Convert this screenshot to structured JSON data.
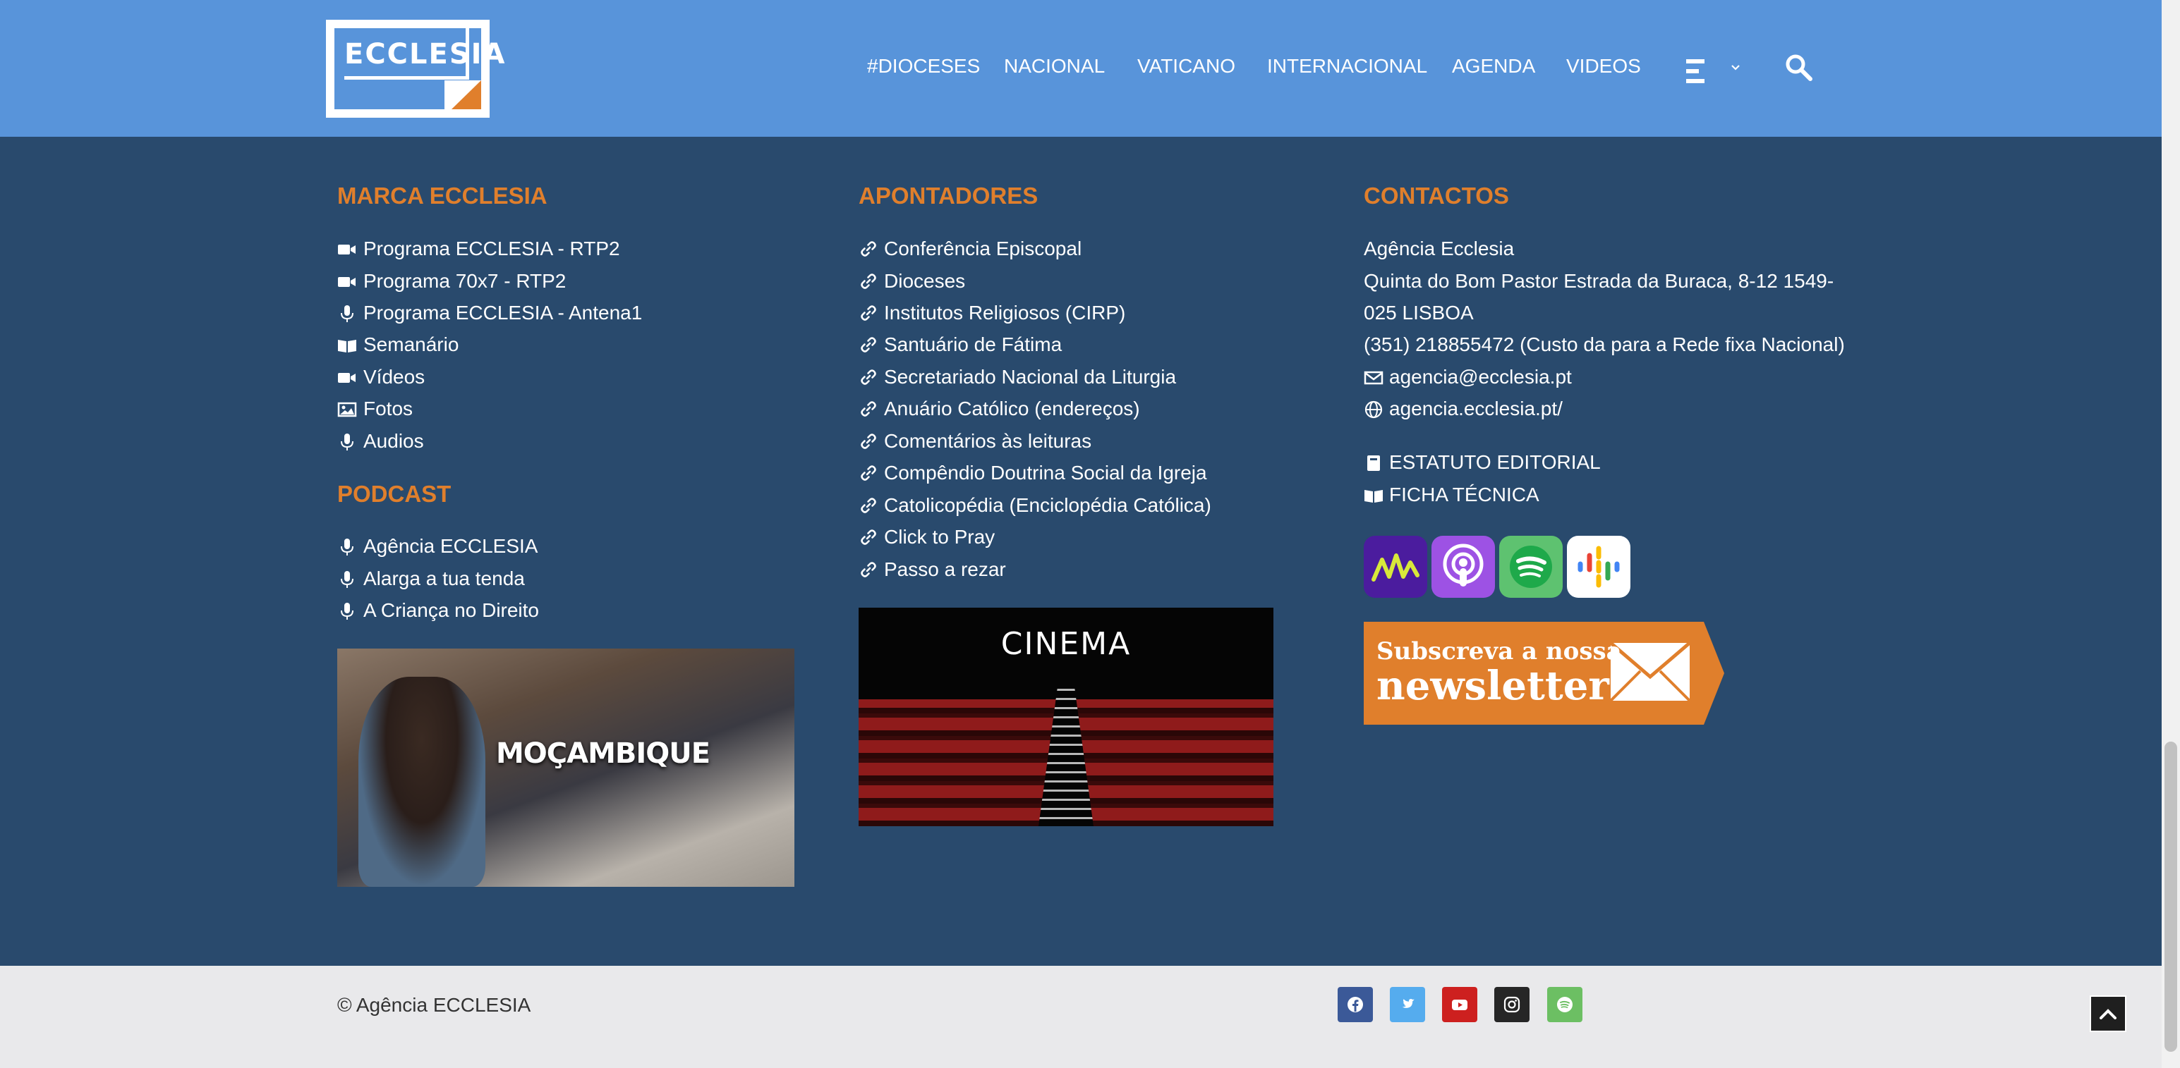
{
  "header": {
    "logo_text": "ECCLESIA",
    "nav": [
      "#DIOCESES",
      "NACIONAL",
      "VATICANO",
      "INTERNACIONAL",
      "AGENDA",
      "VIDEOS"
    ]
  },
  "marca": {
    "title": "MARCA ECCLESIA",
    "items": [
      {
        "icon": "video-camera-icon",
        "label": "Programa ECCLESIA - RTP2"
      },
      {
        "icon": "video-camera-icon",
        "label": "Programa 70x7 - RTP2"
      },
      {
        "icon": "microphone-icon",
        "label": "Programa ECCLESIA - Antena1"
      },
      {
        "icon": "book-open-icon",
        "label": "Semanário"
      },
      {
        "icon": "video-camera-icon",
        "label": "Vídeos"
      },
      {
        "icon": "image-icon",
        "label": "Fotos"
      },
      {
        "icon": "microphone-icon",
        "label": "Audios"
      }
    ]
  },
  "podcast": {
    "title": "PODCAST",
    "items": [
      {
        "icon": "microphone-icon",
        "label": "Agência ECCLESIA"
      },
      {
        "icon": "microphone-icon",
        "label": "Alarga a tua tenda"
      },
      {
        "icon": "microphone-icon",
        "label": "A Criança no Direito"
      }
    ],
    "image_caption": "MOÇAMBIQUE"
  },
  "apontadores": {
    "title": "APONTADORES",
    "items": [
      "Conferência Episcopal",
      "Dioceses",
      "Institutos Religiosos (CIRP)",
      "Santuário de Fátima",
      "Secretariado Nacional da Liturgia",
      "Anuário Católico (endereços)",
      "Comentários às leituras",
      "Compêndio Doutrina Social da Igreja",
      "Catolicopédia (Enciclopédia Católica)",
      "Click to Pray",
      "Passo a rezar"
    ],
    "image_caption": "CINEMA"
  },
  "contactos": {
    "title": "CONTACTOS",
    "name": "Agência Ecclesia",
    "address_line1": "Quinta do Bom Pastor Estrada da Buraca, 8-12 1549-",
    "address_line2": "025 LISBOA",
    "phone": "(351) 218855472 (Custo da para a Rede fixa Nacional)",
    "email": "agencia@ecclesia.pt",
    "website": "agencia.ecclesia.pt/",
    "estatuto": "ESTATUTO EDITORIAL",
    "ficha": "FICHA TÉCNICA",
    "newsletter_line1": "Subscreva a nossa",
    "newsletter_line2": "newsletter"
  },
  "footer": {
    "copyright": "© Agência ECCLESIA"
  },
  "colors": {
    "header_bg": "#5894da",
    "footer_bg": "#294a6d",
    "accent": "#e07f2c",
    "bottom_bg": "#e9e9eb"
  }
}
